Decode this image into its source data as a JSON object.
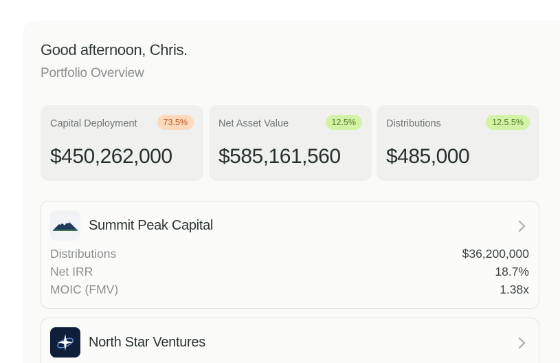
{
  "header": {
    "greeting": "Good afternoon, Chris.",
    "subtitle": "Portfolio Overview"
  },
  "stats": [
    {
      "label": "Capital Deployment",
      "badge": "73.5%",
      "badge_color": "#fcd9b8",
      "value": "$450,262,000"
    },
    {
      "label": "Net Asset Value",
      "badge": "12.5%",
      "badge_color": "#d4f2a5",
      "value": "$585,161,560"
    },
    {
      "label": "Distributions",
      "badge": "12.5.5%",
      "badge_color": "#d4f2a5",
      "value": "$485,000"
    }
  ],
  "funds": [
    {
      "name": "Summit Peak Capital",
      "icon": "mountain-logo-icon",
      "metrics": [
        {
          "label": "Distributions",
          "value": "$36,200,000"
        },
        {
          "label": "Net IRR",
          "value": "18.7%"
        },
        {
          "label": "MOIC (FMV)",
          "value": "1.38x"
        }
      ]
    },
    {
      "name": "North Star Ventures",
      "icon": "star-logo-icon"
    }
  ]
}
